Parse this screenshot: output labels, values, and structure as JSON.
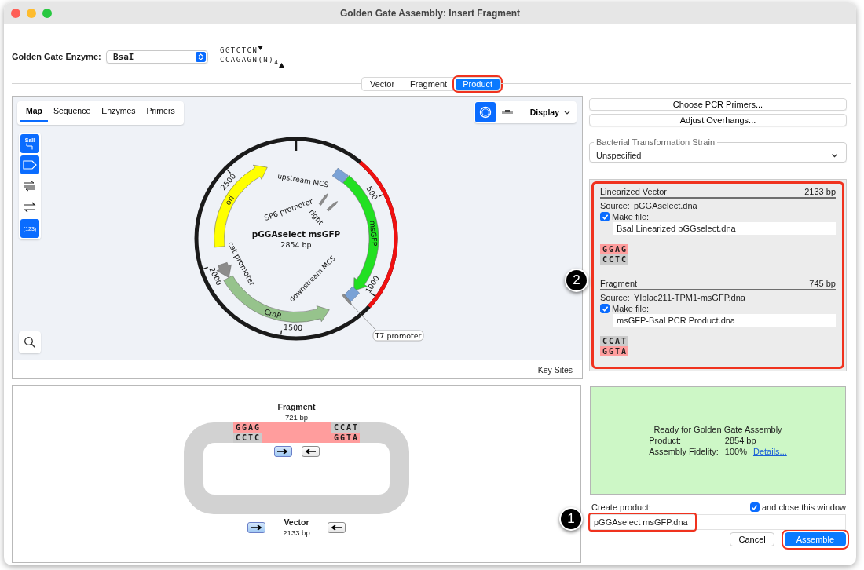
{
  "window": {
    "title": "Golden Gate Assembly: Insert Fragment"
  },
  "enzyme": {
    "label": "Golden Gate Enzyme:",
    "value": "BsaI",
    "site_top": "GGTCTCN",
    "site_bottom": "CCAGAGN(N)$_{4}$"
  },
  "mode_tabs": [
    {
      "label": "Vector",
      "selected": false,
      "highlighted": false
    },
    {
      "label": "Fragment",
      "selected": false,
      "highlighted": false
    },
    {
      "label": "Product",
      "selected": true,
      "highlighted": true
    }
  ],
  "map_view": {
    "tabs": [
      {
        "label": "Map",
        "selected": true
      },
      {
        "label": "Sequence",
        "selected": false
      },
      {
        "label": "Enzymes",
        "selected": false
      },
      {
        "label": "Primers",
        "selected": false
      }
    ],
    "tools": [
      {
        "kind": "enzymes",
        "label": "SalI",
        "selected": true
      },
      {
        "kind": "features",
        "selected": true
      },
      {
        "kind": "strands",
        "selected": false
      },
      {
        "kind": "orientation",
        "selected": false
      },
      {
        "kind": "numbers",
        "label": "(123)",
        "selected": true
      }
    ],
    "view_buttons": [
      {
        "kind": "circular",
        "selected": true
      },
      {
        "kind": "linear",
        "selected": false
      }
    ],
    "display_menu": "Display",
    "plasmid": {
      "name": "pGGAselect msGFP",
      "size": "2854 bp",
      "ticks": [
        "500",
        "1000",
        "1500",
        "2000",
        "2500"
      ],
      "features": [
        {
          "label": "ori",
          "kind": "arrow",
          "color": "#ffff00"
        },
        {
          "label": "msGFP",
          "kind": "arrow",
          "color": "#22e022"
        },
        {
          "label": "CmR",
          "kind": "arrow",
          "color": "#96c38c"
        },
        {
          "label": "cat promoter",
          "kind": "arrow",
          "color": "#8c8c8c"
        },
        {
          "label": "upstream MCS",
          "kind": "box",
          "color": "#7aa2d6"
        },
        {
          "label": "downstream MCS",
          "kind": "box",
          "color": "#7aa2d6"
        },
        {
          "label": "SP6 promoter",
          "kind": "marker",
          "color": "#8c8c8c"
        },
        {
          "label": "right",
          "kind": "marker",
          "color": "#8c8c8c"
        },
        {
          "label": "T7 promoter",
          "kind": "marker",
          "color": "#8c8c8c"
        }
      ]
    },
    "footer": "Key Sites"
  },
  "primer_buttons": [
    "Choose PCR Primers...",
    "Adjust Overhangs..."
  ],
  "strain": {
    "label": "Bacterial Transformation Strain",
    "value": "Unspecified"
  },
  "parts": {
    "highlighted": true,
    "callout": "2",
    "sections": [
      {
        "title": "Linearized Vector",
        "length": "2133 bp",
        "source_label": "Source:",
        "source": "pGGAselect.dna",
        "make_file": "Make file:",
        "checked": true,
        "filename": "Bsal Linearized pGGselect.dna",
        "overhang": {
          "top": "GGAG",
          "bottom": "CCTC",
          "top_highlighted": true,
          "bottom_highlighted": false
        }
      },
      {
        "title": "Fragment",
        "length": "745 bp",
        "source_label": "Source:",
        "source": "YIplac211-TPM1-msGFP.dna",
        "make_file": "Make file:",
        "checked": true,
        "filename": "msGFP-Bsal PCR Product.dna",
        "overhang": {
          "top": "CCAT",
          "bottom": "GGTA",
          "top_highlighted": false,
          "bottom_highlighted": true
        }
      }
    ]
  },
  "diagram": {
    "fragment": {
      "label": "Fragment",
      "size": "721 bp",
      "buttons": [
        {
          "kind": "forward",
          "selected": true
        },
        {
          "kind": "reverse",
          "selected": false
        }
      ]
    },
    "left_overhang": {
      "top": "GGAG",
      "bottom": "CCTC",
      "top_highlighted": true,
      "bottom_highlighted": false
    },
    "right_overhang": {
      "top": "CCAT",
      "bottom": "GGTA",
      "top_highlighted": false,
      "bottom_highlighted": true
    },
    "vector": {
      "label": "Vector",
      "size": "2133 bp",
      "buttons": [
        {
          "kind": "forward",
          "selected": true
        },
        {
          "kind": "reverse",
          "selected": false
        }
      ]
    }
  },
  "status": {
    "title": "Ready for Golden Gate Assembly",
    "rows": [
      {
        "label": "Product:",
        "value": "2854 bp"
      },
      {
        "label": "Assembly Fidelity:",
        "value": "100%",
        "link": "Details..."
      }
    ]
  },
  "create": {
    "label": "Create product:",
    "close_label": "and close this window",
    "close_checked": true,
    "filename": "pGGAselect msGFP.dna",
    "highlighted": true,
    "callout": "1"
  },
  "buttons": [
    {
      "label": "Cancel",
      "kind": "secondary",
      "highlighted": false
    },
    {
      "label": "Assemble",
      "kind": "primary",
      "highlighted": true
    }
  ]
}
